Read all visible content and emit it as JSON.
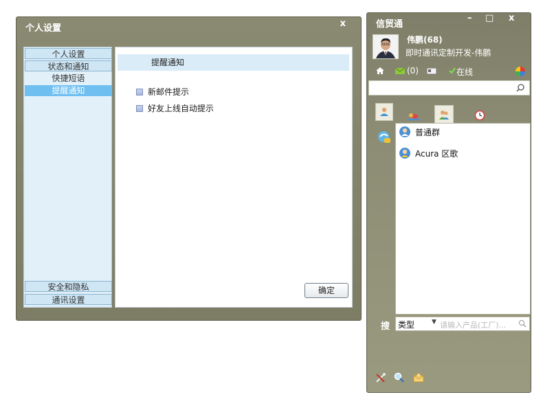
{
  "settings_dialog": {
    "title": "个人设置",
    "close": "x",
    "nav": [
      {
        "label": "个人设置"
      },
      {
        "label": "状态和通知"
      },
      {
        "label": "快捷短语"
      },
      {
        "label": "提醒通知"
      },
      {
        "label": "安全和隐私"
      },
      {
        "label": "通讯设置"
      }
    ],
    "selected_nav": "提醒通知",
    "section_title": "提醒通知",
    "options": [
      {
        "label": "新邮件提示",
        "checked": false
      },
      {
        "label": "好友上线自动提示",
        "checked": false
      }
    ],
    "ok_button": "确定"
  },
  "im_window": {
    "title": "信贸通",
    "minimize": "–",
    "maximize": "□",
    "close": "x",
    "user": {
      "name": "伟鹏(68)",
      "signature": "即时通讯定制开发-伟鹏"
    },
    "status": {
      "mail_count": "(0)",
      "online_label": "在线"
    },
    "search": {
      "placeholder": ""
    },
    "groups": [
      {
        "name": "普通群"
      },
      {
        "name": "Acura 区歌"
      }
    ],
    "filter": {
      "search_label": "搜",
      "type_label": "类型",
      "input_placeholder": "请输入产品(工厂)..."
    },
    "icons": [
      "home-icon",
      "mail-icon",
      "card-icon",
      "online-check-icon",
      "color-wheel-icon",
      "search-icon",
      "contact-tab-icon",
      "friends-tab-icon",
      "group-tab-icon",
      "recent-tab-icon",
      "tools-icon",
      "find-icon",
      "message-icon"
    ],
    "colors": {
      "frame": "#8a8a72",
      "accent_blue": "#6fbff0",
      "panel_blue": "#e1f0f9"
    }
  }
}
